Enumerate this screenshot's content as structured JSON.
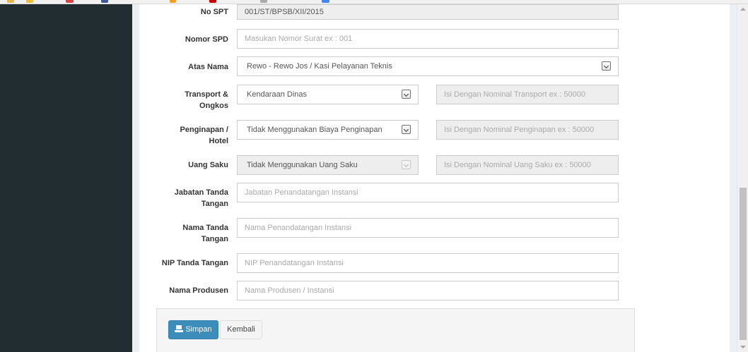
{
  "form": {
    "no_spt": {
      "label": "No SPT",
      "value": "001/ST/BPSB/XII/2015"
    },
    "nomor_spd": {
      "label": "Nomor SPD",
      "placeholder": "Masukan Nomor Surat ex : 001"
    },
    "atas_nama": {
      "label": "Atas Nama",
      "selected": "Rewo - Rewo Jos / Kasi Pelayanan Teknis"
    },
    "transport": {
      "label_line1": "Transport &",
      "label_line2": "Ongkos",
      "selected": "Kendaraan Dinas",
      "nominal_placeholder": "Isi Dengan Nominal Transport ex : 50000"
    },
    "penginapan": {
      "label_line1": "Penginapan /",
      "label_line2": "Hotel",
      "selected": "Tidak Menggunakan Biaya Penginapan",
      "nominal_placeholder": "Isi Dengan Nominal Penginapan ex : 50000"
    },
    "uang_saku": {
      "label": "Uang Saku",
      "selected": "Tidak Menggunakan Uang Saku",
      "nominal_placeholder": "Isi Dengan Nominal Uang Saku ex : 50000"
    },
    "jabatan_ttd": {
      "label_line1": "Jabatan Tanda",
      "label_line2": "Tangan",
      "placeholder": "Jabatan Penandatangan Instansi"
    },
    "nama_ttd": {
      "label_line1": "Nama Tanda",
      "label_line2": "Tangan",
      "placeholder": "Nama Penandatangan Instansi"
    },
    "nip_ttd": {
      "label": "NIP Tanda Tangan",
      "placeholder": "NIP Penandatangan Instansi"
    },
    "nama_produsen": {
      "label": "Nama Produsen",
      "placeholder": "Nama Produsen / Instansi"
    }
  },
  "buttons": {
    "save": "Simpan",
    "back": "Kembali"
  },
  "colors": {
    "sidebar": "#222d32",
    "primary": "#3c8dbc",
    "content_bg": "#ecf0f5"
  }
}
